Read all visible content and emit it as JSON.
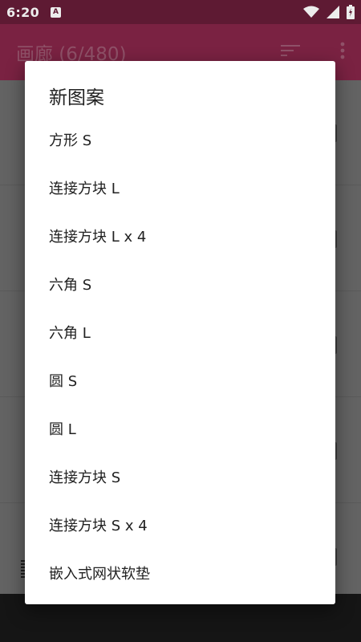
{
  "status_bar": {
    "time": "6:20",
    "a_badge": "A",
    "icons": [
      "wifi-icon",
      "signal-icon",
      "battery-icon"
    ]
  },
  "app_bar": {
    "title": "画廊 (6/480)",
    "icons": [
      "sort-icon",
      "more-vert-icon"
    ]
  },
  "dialog": {
    "title": "新图案",
    "options": [
      "方形 S",
      "连接方块 L",
      "连接方块 L x 4",
      "六角 S",
      "六角 L",
      "圆 S",
      "圆 L",
      "连接方块 S",
      "连接方块 S x 4",
      "嵌入式网状软垫"
    ]
  },
  "colors": {
    "status_bar": "#5e1a33",
    "app_bar": "#7a2242",
    "scrim_content": "#636363",
    "dialog_bg": "#ffffff",
    "text_primary": "#212121"
  }
}
